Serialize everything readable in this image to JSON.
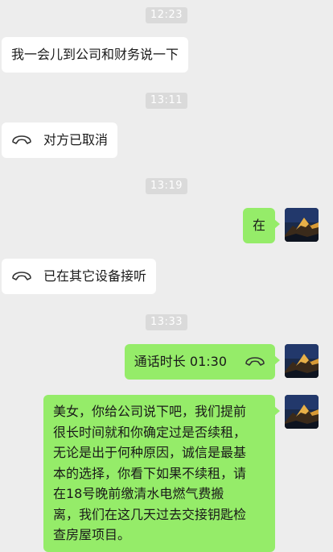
{
  "messages": [
    {
      "type": "time",
      "text": "12:23"
    },
    {
      "type": "in",
      "text": "我一会儿到公司和财务说一下"
    },
    {
      "type": "time",
      "text": "13:11"
    },
    {
      "type": "in_call",
      "text": "对方已取消",
      "icon": "phone-hangup-icon"
    },
    {
      "type": "time",
      "text": "13:19"
    },
    {
      "type": "out",
      "text": "在"
    },
    {
      "type": "in_call",
      "text": "已在其它设备接听",
      "icon": "phone-hangup-icon"
    },
    {
      "type": "time",
      "text": "13:33"
    },
    {
      "type": "out_call",
      "text": "通话时长 01:30",
      "icon": "phone-hangup-icon"
    },
    {
      "type": "out",
      "lines": [
        "美女，你给公司说下吧，我们提前",
        "很长时间就和你确定过是否续租，",
        "无论是出于何种原因，诚信是最基",
        "本的选择，你看下如果不续租，请",
        "在18号晚前缴清水电燃气费搬",
        "离，我们在这几天过去交接钥匙检",
        "查房屋项目。"
      ]
    }
  ],
  "colors": {
    "background": "#ededed",
    "incoming_bubble": "#ffffff",
    "outgoing_bubble": "#95ec69",
    "timestamp_bg": "#dadada"
  },
  "avatar": {
    "icon": "mountain-avatar-icon"
  }
}
